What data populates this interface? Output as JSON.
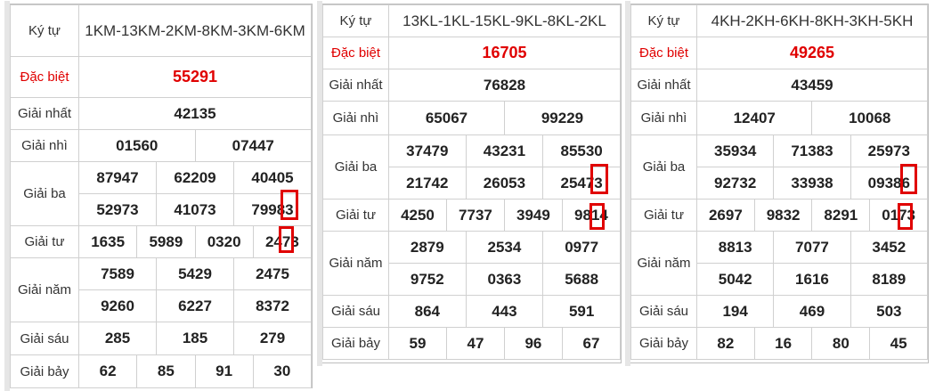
{
  "panels": [
    {
      "label_ky_tu": "Ký tự",
      "ky_tu": "1KM-13KM-2KM-8KM-3KM-6KM",
      "label_dac_biet": "Đặc biệt",
      "dac_biet": "55291",
      "label_nhat": "Giải nhất",
      "nhat": "42135",
      "label_nhi": "Giải nhì",
      "nhi": [
        "01560",
        "07447"
      ],
      "label_ba": "Giải ba",
      "ba": [
        "87947",
        "62209",
        "40405",
        "52973",
        "41073",
        "79983"
      ],
      "label_tu": "Giải tư",
      "tu": [
        "1635",
        "5989",
        "0320",
        "2473"
      ],
      "label_nam": "Giải năm",
      "nam": [
        "7589",
        "5429",
        "2475",
        "9260",
        "6227",
        "8372"
      ],
      "label_sau": "Giải sáu",
      "sau": [
        "285",
        "185",
        "279"
      ],
      "label_bay": "Giải bảy",
      "bay": [
        "62",
        "85",
        "91",
        "30"
      ]
    },
    {
      "label_ky_tu": "Ký tự",
      "ky_tu": "13KL-1KL-15KL-9KL-8KL-2KL",
      "label_dac_biet": "Đặc biệt",
      "dac_biet": "16705",
      "label_nhat": "Giải nhất",
      "nhat": "76828",
      "label_nhi": "Giải nhì",
      "nhi": [
        "65067",
        "99229"
      ],
      "label_ba": "Giải ba",
      "ba": [
        "37479",
        "43231",
        "85530",
        "21742",
        "26053",
        "25473"
      ],
      "label_tu": "Giải tư",
      "tu": [
        "4250",
        "7737",
        "3949",
        "9814"
      ],
      "label_nam": "Giải năm",
      "nam": [
        "2879",
        "2534",
        "0977",
        "9752",
        "0363",
        "5688"
      ],
      "label_sau": "Giải sáu",
      "sau": [
        "864",
        "443",
        "591"
      ],
      "label_bay": "Giải bảy",
      "bay": [
        "59",
        "47",
        "96",
        "67"
      ]
    },
    {
      "label_ky_tu": "Ký tự",
      "ky_tu": "4KH-2KH-6KH-8KH-3KH-5KH",
      "label_dac_biet": "Đặc biệt",
      "dac_biet": "49265",
      "label_nhat": "Giải nhất",
      "nhat": "43459",
      "label_nhi": "Giải nhì",
      "nhi": [
        "12407",
        "10068"
      ],
      "label_ba": "Giải ba",
      "ba": [
        "35934",
        "71383",
        "25973",
        "92732",
        "33938",
        "09386"
      ],
      "label_tu": "Giải tư",
      "tu": [
        "2697",
        "9832",
        "8291",
        "0173"
      ],
      "label_nam": "Giải năm",
      "nam": [
        "8813",
        "7077",
        "3452",
        "5042",
        "1616",
        "8189"
      ],
      "label_sau": "Giải sáu",
      "sau": [
        "194",
        "469",
        "503"
      ],
      "label_bay": "Giải bảy",
      "bay": [
        "82",
        "16",
        "80",
        "45"
      ]
    }
  ],
  "colors": {
    "special": "#e00000",
    "highlight_box": "#e00000",
    "border": "#d0d0d0"
  }
}
